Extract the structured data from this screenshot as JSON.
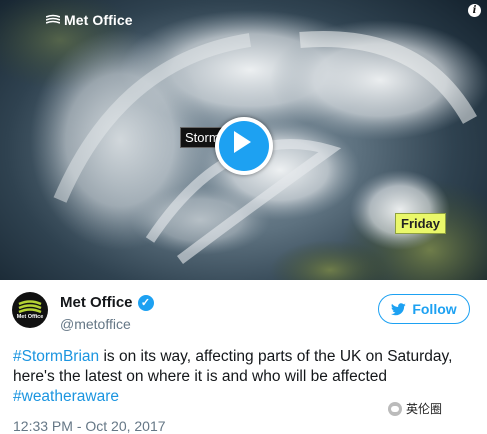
{
  "media": {
    "brand": "Met Office",
    "storm_label": "Storm Brian",
    "friday_label": "Friday",
    "info_label": "i"
  },
  "author": {
    "name": "Met Office",
    "handle": "@metoffice",
    "avatar_label": "Met Office"
  },
  "follow_label": "Follow",
  "tweet": {
    "hashtag1": "#StormBrian",
    "text_mid": " is on its way, affecting parts of the UK on Saturday, here's the latest on where it is and who will be affected ",
    "hashtag2": "#weatheraware"
  },
  "timestamp": "12:33 PM - Oct 20, 2017",
  "watermark": "英伦圈",
  "colors": {
    "accent": "#1da1f2",
    "friday": "#eaf86a"
  }
}
